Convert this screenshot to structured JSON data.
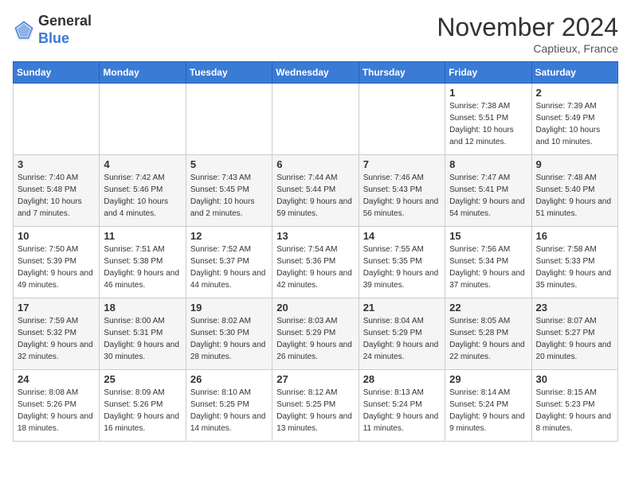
{
  "header": {
    "logo_general": "General",
    "logo_blue": "Blue",
    "month_title": "November 2024",
    "location": "Captieux, France"
  },
  "days_of_week": [
    "Sunday",
    "Monday",
    "Tuesday",
    "Wednesday",
    "Thursday",
    "Friday",
    "Saturday"
  ],
  "weeks": [
    [
      {
        "day": "",
        "info": ""
      },
      {
        "day": "",
        "info": ""
      },
      {
        "day": "",
        "info": ""
      },
      {
        "day": "",
        "info": ""
      },
      {
        "day": "",
        "info": ""
      },
      {
        "day": "1",
        "info": "Sunrise: 7:38 AM\nSunset: 5:51 PM\nDaylight: 10 hours and 12 minutes."
      },
      {
        "day": "2",
        "info": "Sunrise: 7:39 AM\nSunset: 5:49 PM\nDaylight: 10 hours and 10 minutes."
      }
    ],
    [
      {
        "day": "3",
        "info": "Sunrise: 7:40 AM\nSunset: 5:48 PM\nDaylight: 10 hours and 7 minutes."
      },
      {
        "day": "4",
        "info": "Sunrise: 7:42 AM\nSunset: 5:46 PM\nDaylight: 10 hours and 4 minutes."
      },
      {
        "day": "5",
        "info": "Sunrise: 7:43 AM\nSunset: 5:45 PM\nDaylight: 10 hours and 2 minutes."
      },
      {
        "day": "6",
        "info": "Sunrise: 7:44 AM\nSunset: 5:44 PM\nDaylight: 9 hours and 59 minutes."
      },
      {
        "day": "7",
        "info": "Sunrise: 7:46 AM\nSunset: 5:43 PM\nDaylight: 9 hours and 56 minutes."
      },
      {
        "day": "8",
        "info": "Sunrise: 7:47 AM\nSunset: 5:41 PM\nDaylight: 9 hours and 54 minutes."
      },
      {
        "day": "9",
        "info": "Sunrise: 7:48 AM\nSunset: 5:40 PM\nDaylight: 9 hours and 51 minutes."
      }
    ],
    [
      {
        "day": "10",
        "info": "Sunrise: 7:50 AM\nSunset: 5:39 PM\nDaylight: 9 hours and 49 minutes."
      },
      {
        "day": "11",
        "info": "Sunrise: 7:51 AM\nSunset: 5:38 PM\nDaylight: 9 hours and 46 minutes."
      },
      {
        "day": "12",
        "info": "Sunrise: 7:52 AM\nSunset: 5:37 PM\nDaylight: 9 hours and 44 minutes."
      },
      {
        "day": "13",
        "info": "Sunrise: 7:54 AM\nSunset: 5:36 PM\nDaylight: 9 hours and 42 minutes."
      },
      {
        "day": "14",
        "info": "Sunrise: 7:55 AM\nSunset: 5:35 PM\nDaylight: 9 hours and 39 minutes."
      },
      {
        "day": "15",
        "info": "Sunrise: 7:56 AM\nSunset: 5:34 PM\nDaylight: 9 hours and 37 minutes."
      },
      {
        "day": "16",
        "info": "Sunrise: 7:58 AM\nSunset: 5:33 PM\nDaylight: 9 hours and 35 minutes."
      }
    ],
    [
      {
        "day": "17",
        "info": "Sunrise: 7:59 AM\nSunset: 5:32 PM\nDaylight: 9 hours and 32 minutes."
      },
      {
        "day": "18",
        "info": "Sunrise: 8:00 AM\nSunset: 5:31 PM\nDaylight: 9 hours and 30 minutes."
      },
      {
        "day": "19",
        "info": "Sunrise: 8:02 AM\nSunset: 5:30 PM\nDaylight: 9 hours and 28 minutes."
      },
      {
        "day": "20",
        "info": "Sunrise: 8:03 AM\nSunset: 5:29 PM\nDaylight: 9 hours and 26 minutes."
      },
      {
        "day": "21",
        "info": "Sunrise: 8:04 AM\nSunset: 5:29 PM\nDaylight: 9 hours and 24 minutes."
      },
      {
        "day": "22",
        "info": "Sunrise: 8:05 AM\nSunset: 5:28 PM\nDaylight: 9 hours and 22 minutes."
      },
      {
        "day": "23",
        "info": "Sunrise: 8:07 AM\nSunset: 5:27 PM\nDaylight: 9 hours and 20 minutes."
      }
    ],
    [
      {
        "day": "24",
        "info": "Sunrise: 8:08 AM\nSunset: 5:26 PM\nDaylight: 9 hours and 18 minutes."
      },
      {
        "day": "25",
        "info": "Sunrise: 8:09 AM\nSunset: 5:26 PM\nDaylight: 9 hours and 16 minutes."
      },
      {
        "day": "26",
        "info": "Sunrise: 8:10 AM\nSunset: 5:25 PM\nDaylight: 9 hours and 14 minutes."
      },
      {
        "day": "27",
        "info": "Sunrise: 8:12 AM\nSunset: 5:25 PM\nDaylight: 9 hours and 13 minutes."
      },
      {
        "day": "28",
        "info": "Sunrise: 8:13 AM\nSunset: 5:24 PM\nDaylight: 9 hours and 11 minutes."
      },
      {
        "day": "29",
        "info": "Sunrise: 8:14 AM\nSunset: 5:24 PM\nDaylight: 9 hours and 9 minutes."
      },
      {
        "day": "30",
        "info": "Sunrise: 8:15 AM\nSunset: 5:23 PM\nDaylight: 9 hours and 8 minutes."
      }
    ]
  ]
}
